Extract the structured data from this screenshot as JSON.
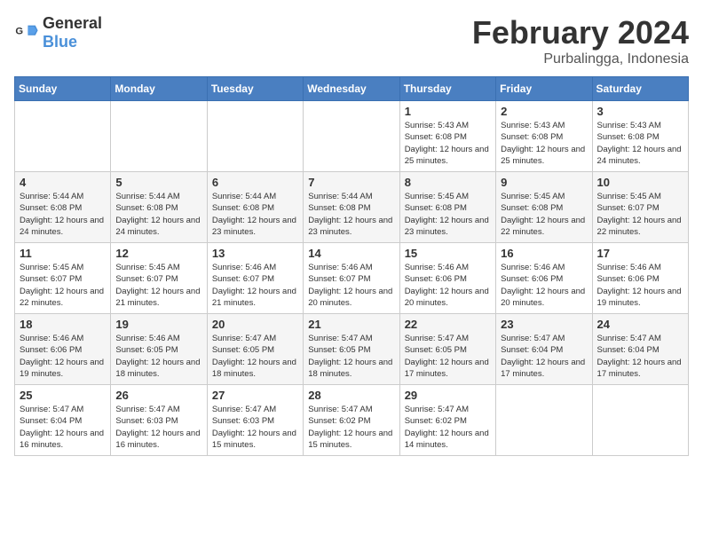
{
  "header": {
    "logo_general": "General",
    "logo_blue": "Blue",
    "title": "February 2024",
    "subtitle": "Purbalingga, Indonesia"
  },
  "calendar": {
    "days_of_week": [
      "Sunday",
      "Monday",
      "Tuesday",
      "Wednesday",
      "Thursday",
      "Friday",
      "Saturday"
    ],
    "weeks": [
      {
        "cells": [
          {
            "empty": true
          },
          {
            "empty": true
          },
          {
            "empty": true
          },
          {
            "empty": true
          },
          {
            "day": "1",
            "sunrise": "5:43 AM",
            "sunset": "6:08 PM",
            "daylight": "12 hours and 25 minutes."
          },
          {
            "day": "2",
            "sunrise": "5:43 AM",
            "sunset": "6:08 PM",
            "daylight": "12 hours and 25 minutes."
          },
          {
            "day": "3",
            "sunrise": "5:43 AM",
            "sunset": "6:08 PM",
            "daylight": "12 hours and 24 minutes."
          }
        ]
      },
      {
        "cells": [
          {
            "day": "4",
            "sunrise": "5:44 AM",
            "sunset": "6:08 PM",
            "daylight": "12 hours and 24 minutes."
          },
          {
            "day": "5",
            "sunrise": "5:44 AM",
            "sunset": "6:08 PM",
            "daylight": "12 hours and 24 minutes."
          },
          {
            "day": "6",
            "sunrise": "5:44 AM",
            "sunset": "6:08 PM",
            "daylight": "12 hours and 23 minutes."
          },
          {
            "day": "7",
            "sunrise": "5:44 AM",
            "sunset": "6:08 PM",
            "daylight": "12 hours and 23 minutes."
          },
          {
            "day": "8",
            "sunrise": "5:45 AM",
            "sunset": "6:08 PM",
            "daylight": "12 hours and 23 minutes."
          },
          {
            "day": "9",
            "sunrise": "5:45 AM",
            "sunset": "6:08 PM",
            "daylight": "12 hours and 22 minutes."
          },
          {
            "day": "10",
            "sunrise": "5:45 AM",
            "sunset": "6:07 PM",
            "daylight": "12 hours and 22 minutes."
          }
        ]
      },
      {
        "cells": [
          {
            "day": "11",
            "sunrise": "5:45 AM",
            "sunset": "6:07 PM",
            "daylight": "12 hours and 22 minutes."
          },
          {
            "day": "12",
            "sunrise": "5:45 AM",
            "sunset": "6:07 PM",
            "daylight": "12 hours and 21 minutes."
          },
          {
            "day": "13",
            "sunrise": "5:46 AM",
            "sunset": "6:07 PM",
            "daylight": "12 hours and 21 minutes."
          },
          {
            "day": "14",
            "sunrise": "5:46 AM",
            "sunset": "6:07 PM",
            "daylight": "12 hours and 20 minutes."
          },
          {
            "day": "15",
            "sunrise": "5:46 AM",
            "sunset": "6:06 PM",
            "daylight": "12 hours and 20 minutes."
          },
          {
            "day": "16",
            "sunrise": "5:46 AM",
            "sunset": "6:06 PM",
            "daylight": "12 hours and 20 minutes."
          },
          {
            "day": "17",
            "sunrise": "5:46 AM",
            "sunset": "6:06 PM",
            "daylight": "12 hours and 19 minutes."
          }
        ]
      },
      {
        "cells": [
          {
            "day": "18",
            "sunrise": "5:46 AM",
            "sunset": "6:06 PM",
            "daylight": "12 hours and 19 minutes."
          },
          {
            "day": "19",
            "sunrise": "5:46 AM",
            "sunset": "6:05 PM",
            "daylight": "12 hours and 18 minutes."
          },
          {
            "day": "20",
            "sunrise": "5:47 AM",
            "sunset": "6:05 PM",
            "daylight": "12 hours and 18 minutes."
          },
          {
            "day": "21",
            "sunrise": "5:47 AM",
            "sunset": "6:05 PM",
            "daylight": "12 hours and 18 minutes."
          },
          {
            "day": "22",
            "sunrise": "5:47 AM",
            "sunset": "6:05 PM",
            "daylight": "12 hours and 17 minutes."
          },
          {
            "day": "23",
            "sunrise": "5:47 AM",
            "sunset": "6:04 PM",
            "daylight": "12 hours and 17 minutes."
          },
          {
            "day": "24",
            "sunrise": "5:47 AM",
            "sunset": "6:04 PM",
            "daylight": "12 hours and 17 minutes."
          }
        ]
      },
      {
        "cells": [
          {
            "day": "25",
            "sunrise": "5:47 AM",
            "sunset": "6:04 PM",
            "daylight": "12 hours and 16 minutes."
          },
          {
            "day": "26",
            "sunrise": "5:47 AM",
            "sunset": "6:03 PM",
            "daylight": "12 hours and 16 minutes."
          },
          {
            "day": "27",
            "sunrise": "5:47 AM",
            "sunset": "6:03 PM",
            "daylight": "12 hours and 15 minutes."
          },
          {
            "day": "28",
            "sunrise": "5:47 AM",
            "sunset": "6:02 PM",
            "daylight": "12 hours and 15 minutes."
          },
          {
            "day": "29",
            "sunrise": "5:47 AM",
            "sunset": "6:02 PM",
            "daylight": "12 hours and 14 minutes."
          },
          {
            "empty": true
          },
          {
            "empty": true
          }
        ]
      }
    ]
  }
}
